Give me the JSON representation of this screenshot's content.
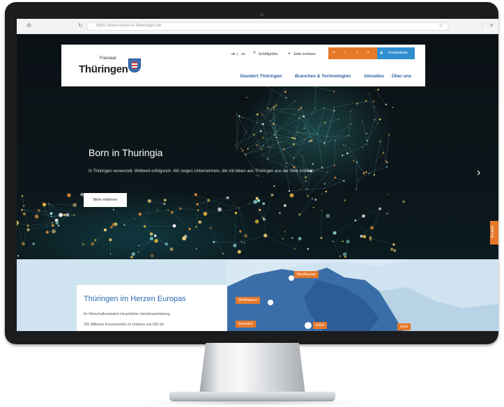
{
  "browser": {
    "url": "https://www.invest-in-thueringen.de"
  },
  "header": {
    "logo_small": "Freistaat",
    "logo_big": "Thüringen",
    "lang_de": "de",
    "lang_en": "en",
    "util_1": "Schriftgröße",
    "util_2": "Seite vorlesen",
    "login": "Kontaktieren",
    "nav": [
      "Standort Thüringen",
      "Branchen & Technologien",
      "Aktuelles",
      "Über uns"
    ]
  },
  "hero": {
    "title": "Born in Thuringia",
    "text": "In Thüringen verwurzelt. Weltweit erfolgreich. Wir zeigen Unternehmen, die mit Ideen aus Thüringen aus der Welt erobern.",
    "button": "Mehr erfahren",
    "side_tab": "Kontakt"
  },
  "map_section": {
    "title": "Thüringen im Herzen Europas",
    "line1": "Ihr Wirtschaftsstandort mit perfekter Verkehrsanbindung",
    "line2": "200 Millionen Konsumenten im Umkreis von 500 km",
    "cities": [
      "Nordhausen",
      "Mühlhausen",
      "Eisenach",
      "Erfurt",
      "Jena"
    ]
  }
}
